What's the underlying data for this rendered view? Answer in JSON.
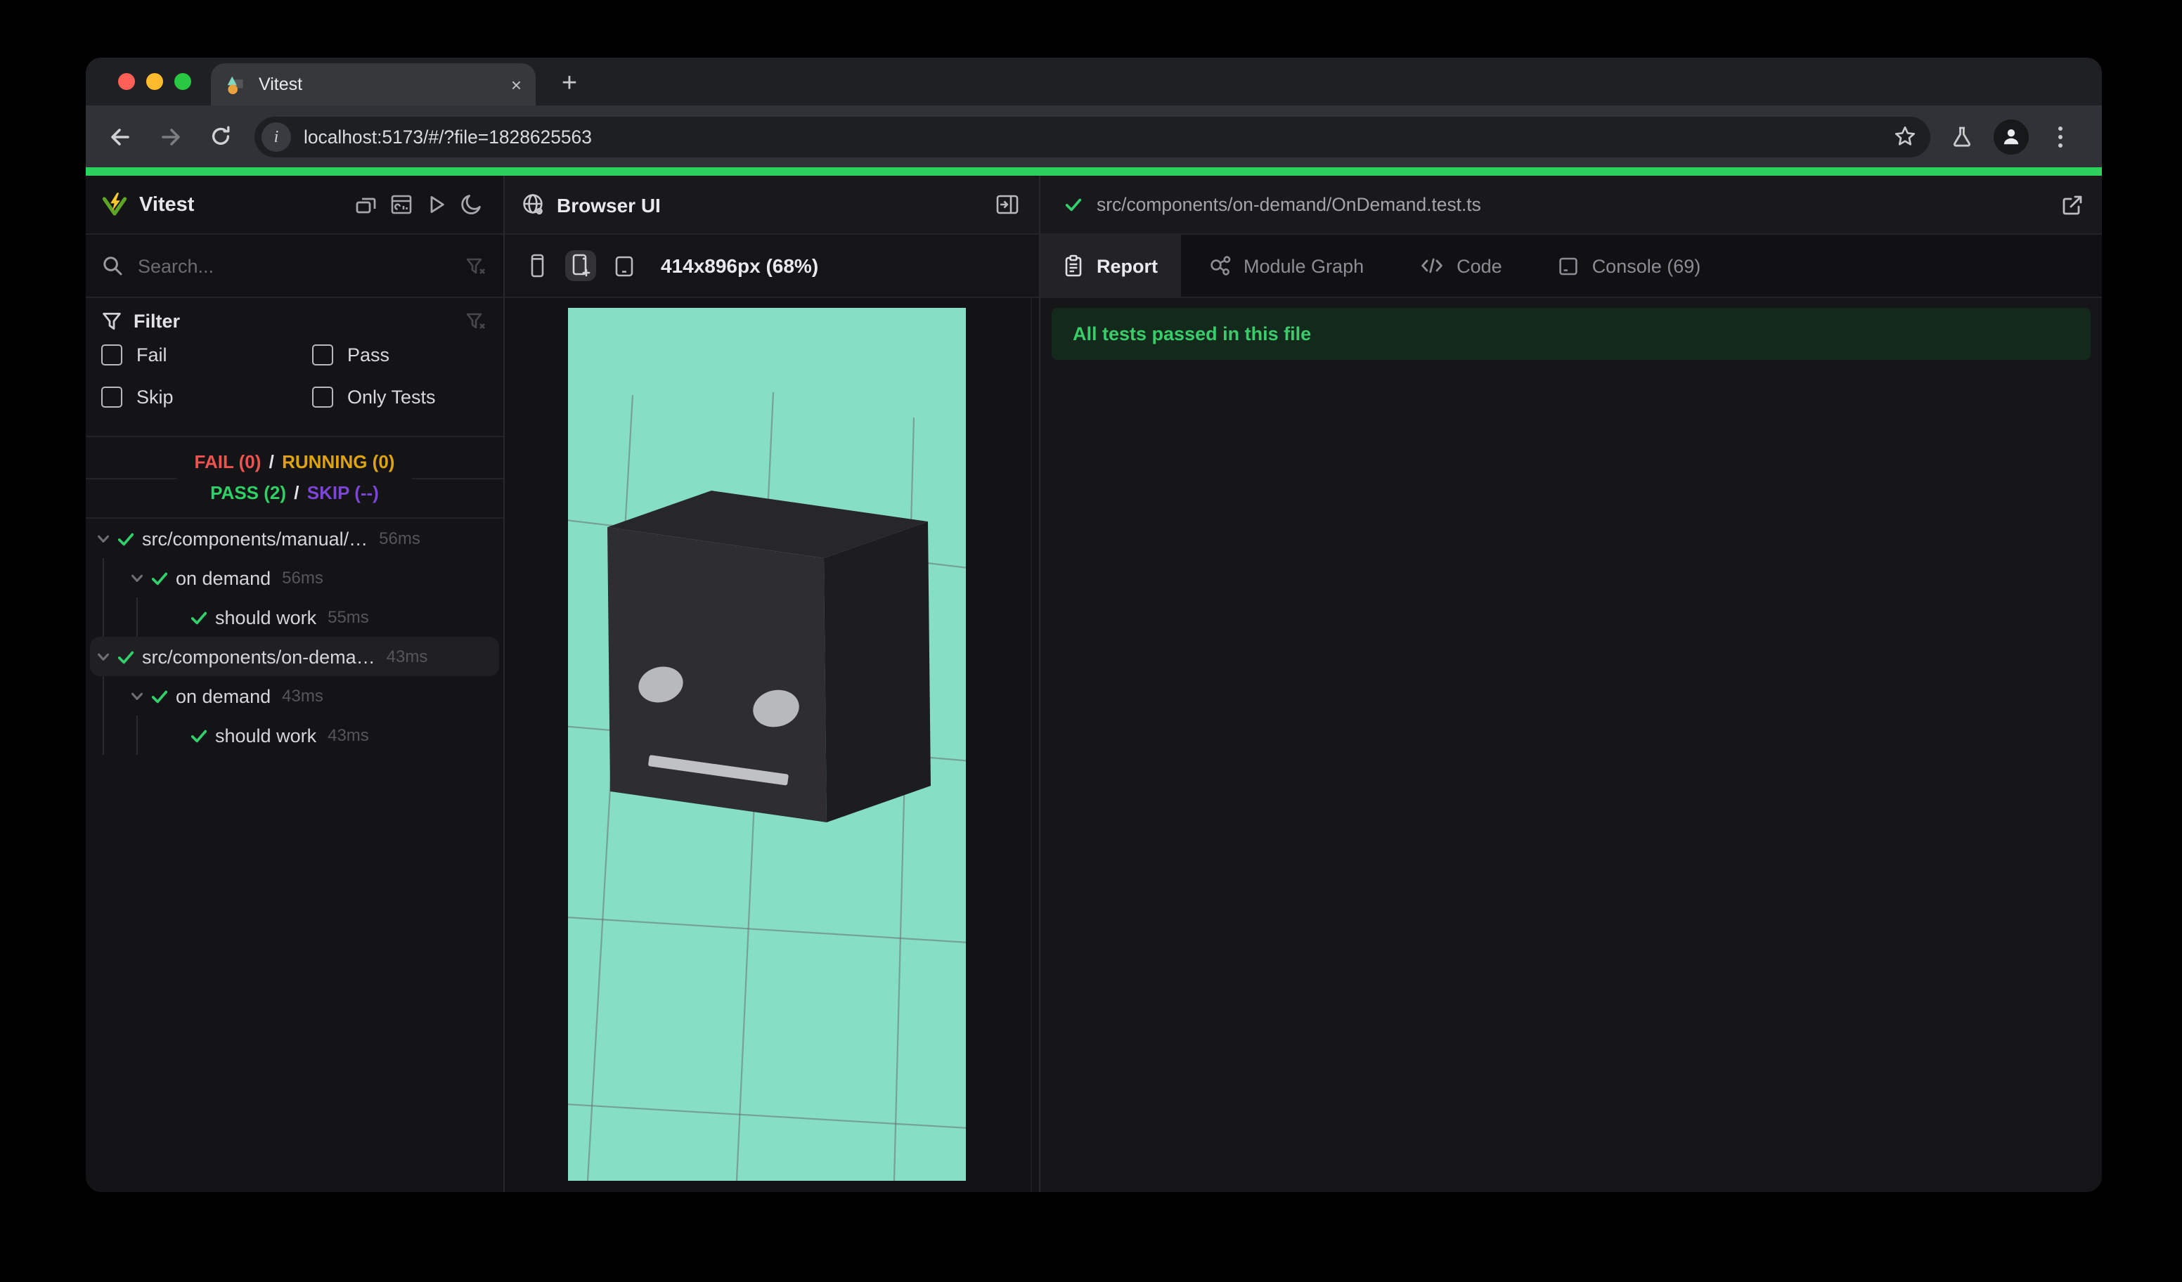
{
  "chrome": {
    "tab_title": "Vitest",
    "tab_close": "×",
    "new_tab": "+",
    "url": "localhost:5173/#/?file=1828625563",
    "info_glyph": "i"
  },
  "app": {
    "accent_green": "#2bd15c",
    "sidebar": {
      "title": "Vitest",
      "search_placeholder": "Search...",
      "filter_title": "Filter",
      "filter_options": [
        "Fail",
        "Pass",
        "Skip",
        "Only Tests"
      ],
      "summary": {
        "fail": "FAIL (0)",
        "running": "RUNNING (0)",
        "pass": "PASS (2)",
        "skip": "SKIP (--)",
        "separator": "/"
      },
      "tree": [
        {
          "label": "src/components/manual/…",
          "duration": "56ms"
        },
        {
          "label": "on demand",
          "duration": "56ms"
        },
        {
          "label": "should work",
          "duration": "55ms"
        },
        {
          "label": "src/components/on-dema…",
          "duration": "43ms"
        },
        {
          "label": "on demand",
          "duration": "43ms"
        },
        {
          "label": "should work",
          "duration": "43ms"
        }
      ]
    },
    "browser_panel": {
      "title": "Browser UI",
      "viewport_info": "414x896px (68%)",
      "scene_background": "#86dfc2"
    },
    "report_panel": {
      "file_path": "src/components/on-demand/OnDemand.test.ts",
      "tabs": [
        "Report",
        "Module Graph",
        "Code",
        "Console (69)"
      ],
      "active_tab": "Report",
      "banner": "All tests passed in this file",
      "banner_bg": "#12291b",
      "banner_fg": "#3acc6a"
    },
    "status_colors": {
      "fail": "#ef5350",
      "running": "#dfa30f",
      "pass": "#2fd068",
      "skip": "#7c45d8"
    }
  }
}
